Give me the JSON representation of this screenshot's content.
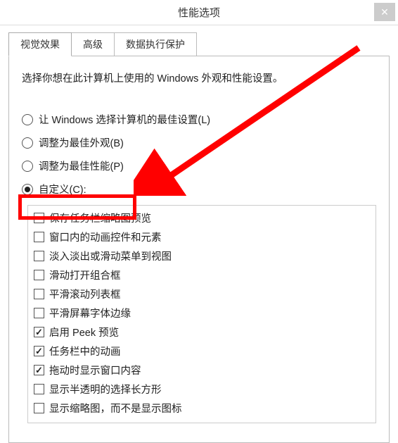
{
  "titlebar": {
    "title": "性能选项",
    "close": "✕"
  },
  "tabs": [
    {
      "label": "视觉效果",
      "active": true
    },
    {
      "label": "高级",
      "active": false
    },
    {
      "label": "数据执行保护",
      "active": false
    }
  ],
  "description": "选择你想在此计算机上使用的 Windows 外观和性能设置。",
  "radios": [
    {
      "label": "让 Windows 选择计算机的最佳设置(L)",
      "checked": false
    },
    {
      "label": "调整为最佳外观(B)",
      "checked": false
    },
    {
      "label": "调整为最佳性能(P)",
      "checked": false
    },
    {
      "label": "自定义(C):",
      "checked": true
    }
  ],
  "checkboxes": [
    {
      "label": "保存任务栏缩略图预览",
      "checked": false
    },
    {
      "label": "窗口内的动画控件和元素",
      "checked": false
    },
    {
      "label": "淡入淡出或滑动菜单到视图",
      "checked": false
    },
    {
      "label": "滑动打开组合框",
      "checked": false
    },
    {
      "label": "平滑滚动列表框",
      "checked": false
    },
    {
      "label": "平滑屏幕字体边缘",
      "checked": false
    },
    {
      "label": "启用 Peek 预览",
      "checked": true
    },
    {
      "label": "任务栏中的动画",
      "checked": true
    },
    {
      "label": "拖动时显示窗口内容",
      "checked": true
    },
    {
      "label": "显示半透明的选择长方形",
      "checked": false
    },
    {
      "label": "显示缩略图，而不是显示图标",
      "checked": false
    }
  ]
}
